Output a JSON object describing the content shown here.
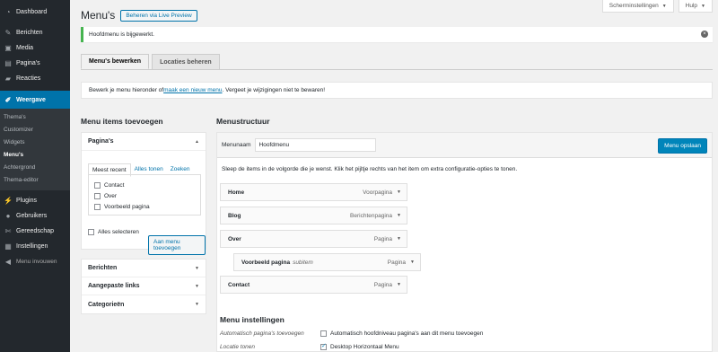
{
  "sidebar": {
    "items": [
      {
        "label": "Dashboard",
        "icon": "dashboard-icon"
      },
      {
        "label": "Berichten",
        "icon": "pin-icon"
      },
      {
        "label": "Media",
        "icon": "media-icon"
      },
      {
        "label": "Pagina's",
        "icon": "pages-icon"
      },
      {
        "label": "Reacties",
        "icon": "comment-icon"
      },
      {
        "label": "Weergave",
        "icon": "brush-icon"
      },
      {
        "label": "Plugins",
        "icon": "plug-icon"
      },
      {
        "label": "Gebruikers",
        "icon": "user-icon"
      },
      {
        "label": "Gereedschap",
        "icon": "wrench-icon"
      },
      {
        "label": "Instellingen",
        "icon": "settings-icon"
      },
      {
        "label": "Menu invouwen",
        "icon": "collapse-icon"
      }
    ],
    "submenu": [
      "Thema's",
      "Customizer",
      "Widgets",
      "Menu's",
      "Achtergrond",
      "Thema-editor"
    ]
  },
  "header": {
    "title": "Menu's",
    "live_preview": "Beheren via Live Preview",
    "screen_options": "Scherminstellingen",
    "help": "Hulp"
  },
  "notice": {
    "text": "Hoofdmenu is bijgewerkt."
  },
  "tabs": [
    "Menu's bewerken",
    "Locaties beheren"
  ],
  "manage": {
    "before": "Bewerk je menu hieronder of ",
    "link": "maak een nieuw menu",
    "after": ". Vergeet je wijzigingen niet te bewaren!"
  },
  "left": {
    "title": "Menu items toevoegen",
    "pages_panel": {
      "title": "Pagina's",
      "tabs": [
        "Meest recent",
        "Alles tonen",
        "Zoeken"
      ],
      "items": [
        "Contact",
        "Over",
        "Voorbeeld pagina"
      ],
      "select_all": "Alles selecteren",
      "add_button": "Aan menu toevoegen"
    },
    "sections": [
      "Berichten",
      "Aangepaste links",
      "Categorieën"
    ]
  },
  "right": {
    "title": "Menustructuur",
    "name_label": "Menunaam",
    "name_value": "Hoofdmenu",
    "save": "Menu opslaan",
    "instructions": "Sleep de items in de volgorde die je wenst. Klik het pijltje rechts van het item om extra configuratie-opties te tonen.",
    "items": [
      {
        "name": "Home",
        "sub": "",
        "type": "Voorpagina"
      },
      {
        "name": "Blog",
        "sub": "",
        "type": "Berichtenpagina"
      },
      {
        "name": "Over",
        "sub": "",
        "type": "Pagina"
      },
      {
        "name": "Voorbeeld pagina",
        "sub": "subitem",
        "type": "Pagina"
      },
      {
        "name": "Contact",
        "sub": "",
        "type": "Pagina"
      }
    ],
    "settings": {
      "title": "Menu instellingen",
      "auto_label": "Automatisch pagina's toevoegen",
      "auto_text": "Automatisch hoofdniveau pagina's aan dit menu toevoegen",
      "location_label": "Locatie tonen",
      "location_text": "Desktop Horizontaal Menu"
    }
  },
  "colors": {
    "sidebar": "#23282d",
    "accent": "#0073aa",
    "success": "#46b450"
  }
}
